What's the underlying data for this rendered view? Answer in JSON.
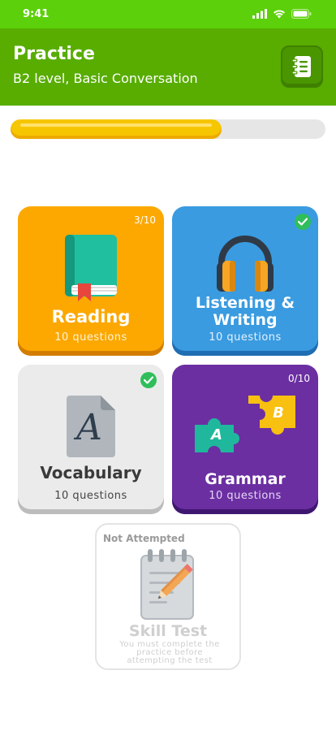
{
  "status_bar": {
    "time": "9:41"
  },
  "header": {
    "title": "Practice",
    "subtitle": "B2 level, Basic Conversation",
    "notes_icon": "notebook-icon"
  },
  "progress": {
    "fraction": 0.67
  },
  "cards": {
    "reading": {
      "label": "Reading",
      "subtitle": "10 questions",
      "count": "3/10",
      "icon": "book-icon",
      "color": "#fca800"
    },
    "listening": {
      "label_line1": "Listening &",
      "label_line2": "Writing",
      "subtitle": "10 questions",
      "completed": true,
      "icon": "headphones-icon",
      "color": "#3a9be0"
    },
    "vocabulary": {
      "label": "Vocabulary",
      "subtitle": "10 questions",
      "completed": true,
      "icon": "document-icon",
      "icon_letter": "A",
      "color": "#ebebeb"
    },
    "grammar": {
      "label": "Grammar",
      "subtitle": "10 questions",
      "count": "0/10",
      "icon": "puzzle-icon",
      "piece_a": "A",
      "piece_b": "B",
      "color": "#6b2fa2"
    }
  },
  "skill_test": {
    "status": "Not Attempted",
    "title": "Skill Test",
    "note_line1": "You must complete the",
    "note_line2": "practice before",
    "note_line3": "attempting the test",
    "icon": "notepad-pencil-icon"
  }
}
